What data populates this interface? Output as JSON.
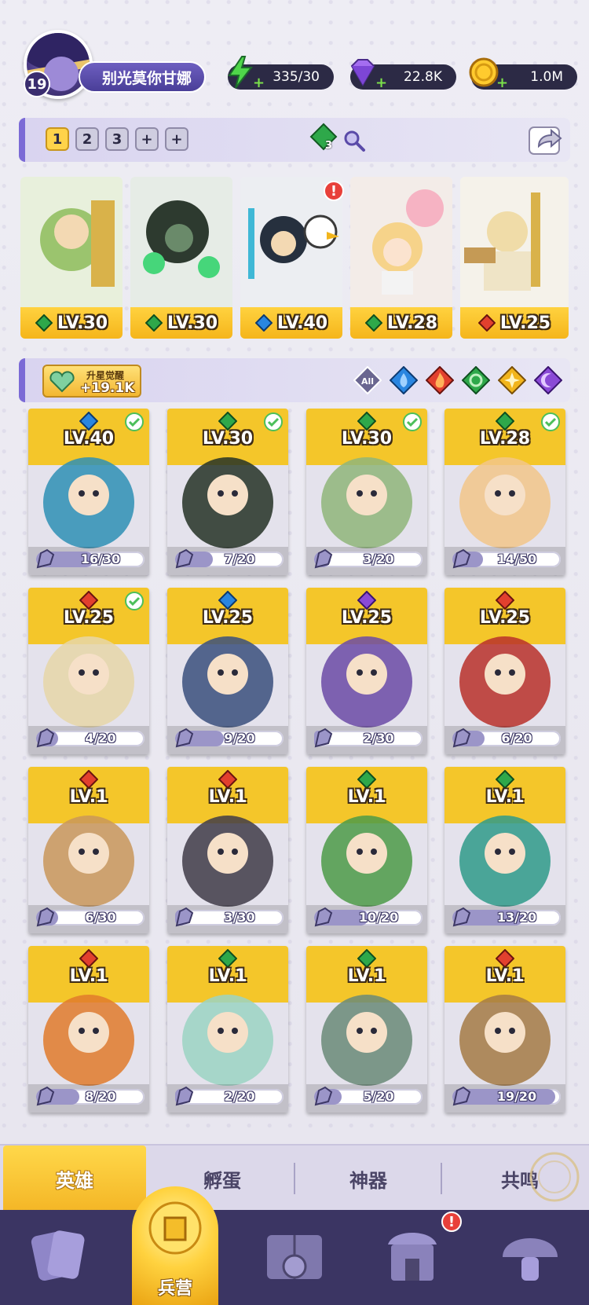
{
  "player": {
    "level": "19",
    "name": "别光莫你甘娜"
  },
  "resources": {
    "energy": "335/30",
    "gems": "22.8K",
    "gold": "1.0M"
  },
  "team_bar": {
    "slots": [
      "1",
      "2",
      "3",
      "+",
      "+"
    ],
    "active_slot": "1",
    "badge_count": "3"
  },
  "team_heroes": [
    {
      "level": "LV.30",
      "element": "nature",
      "alert": false
    },
    {
      "level": "LV.30",
      "element": "nature",
      "alert": false
    },
    {
      "level": "LV.40",
      "element": "water",
      "alert": true
    },
    {
      "level": "LV.28",
      "element": "nature",
      "alert": false
    },
    {
      "level": "LV.25",
      "element": "fire",
      "alert": false
    }
  ],
  "awaken": {
    "label": "升星觉醒",
    "value": "+19.1K"
  },
  "filters": [
    "All",
    "water",
    "fire",
    "nature",
    "light",
    "dark"
  ],
  "filter_all_label": "All",
  "heroes": [
    {
      "level": "LV.40",
      "element": "water",
      "shards": "16/30",
      "fraction": 0.53,
      "checked": true,
      "palette": "#2e8fb5"
    },
    {
      "level": "LV.30",
      "element": "nature",
      "shards": "7/20",
      "fraction": 0.35,
      "checked": true,
      "palette": "#243126"
    },
    {
      "level": "LV.30",
      "element": "nature",
      "shards": "3/20",
      "fraction": 0.15,
      "checked": true,
      "palette": "#8fb57a"
    },
    {
      "level": "LV.28",
      "element": "nature",
      "shards": "14/50",
      "fraction": 0.28,
      "checked": true,
      "palette": "#f2c68a"
    },
    {
      "level": "LV.25",
      "element": "fire",
      "shards": "4/20",
      "fraction": 0.2,
      "checked": true,
      "palette": "#e6d6a8"
    },
    {
      "level": "LV.25",
      "element": "water",
      "shards": "9/20",
      "fraction": 0.45,
      "checked": false,
      "palette": "#3a4f7c"
    },
    {
      "level": "LV.25",
      "element": "dark",
      "shards": "2/30",
      "fraction": 0.07,
      "checked": false,
      "palette": "#6b4aa6"
    },
    {
      "level": "LV.25",
      "element": "fire",
      "shards": "6/20",
      "fraction": 0.3,
      "checked": false,
      "palette": "#b8302a"
    },
    {
      "level": "LV.1",
      "element": "fire",
      "shards": "6/30",
      "fraction": 0.2,
      "checked": false,
      "palette": "#c9975a"
    },
    {
      "level": "LV.1",
      "element": "fire",
      "shards": "3/30",
      "fraction": 0.1,
      "checked": false,
      "palette": "#403b48"
    },
    {
      "level": "LV.1",
      "element": "nature",
      "shards": "10/20",
      "fraction": 0.5,
      "checked": false,
      "palette": "#4c9a48"
    },
    {
      "level": "LV.1",
      "element": "nature",
      "shards": "13/20",
      "fraction": 0.65,
      "checked": false,
      "palette": "#2f9a8a"
    },
    {
      "level": "LV.1",
      "element": "fire",
      "shards": "8/20",
      "fraction": 0.4,
      "checked": false,
      "palette": "#e07a2c"
    },
    {
      "level": "LV.1",
      "element": "nature",
      "shards": "2/20",
      "fraction": 0.1,
      "checked": false,
      "palette": "#9bd3c3"
    },
    {
      "level": "LV.1",
      "element": "nature",
      "shards": "5/20",
      "fraction": 0.25,
      "checked": false,
      "palette": "#6a8a78"
    },
    {
      "level": "LV.1",
      "element": "fire",
      "shards": "19/20",
      "fraction": 0.95,
      "checked": false,
      "palette": "#a47a45"
    }
  ],
  "sub_tabs": [
    "英雄",
    "孵蛋",
    "神器",
    "共鸣"
  ],
  "active_sub_tab": "英雄",
  "bottom_nav": {
    "active_label": "兵营",
    "items": [
      "cards-icon",
      "barracks-icon",
      "map-book-icon",
      "temple-icon",
      "mushroom-icon"
    ],
    "alert_on": "temple-icon"
  },
  "colors": {
    "accent_gold": "#f5b51b",
    "accent_purple": "#7b6ad6",
    "nav_bg": "#3b3563",
    "water": "#2a86e0",
    "fire": "#e2402e",
    "nature": "#2ea84a",
    "light": "#f2b51c",
    "dark": "#8a4ad6"
  }
}
